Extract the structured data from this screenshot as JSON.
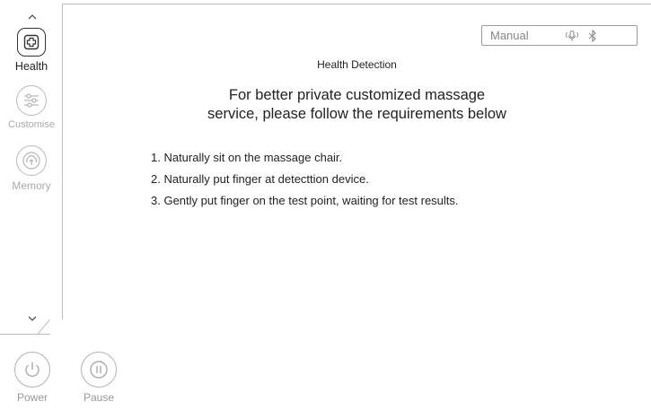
{
  "sidebar": {
    "items": [
      {
        "label": "Health",
        "icon": "health-cross-icon",
        "active": true
      },
      {
        "label": "Customise",
        "icon": "sliders-icon",
        "active": false
      },
      {
        "label": "Memory",
        "icon": "cloud-upload-icon",
        "active": false
      }
    ]
  },
  "controls": {
    "power_label": "Power",
    "pause_label": "Pause"
  },
  "status_bar": {
    "mode": "Manual",
    "icons": [
      "voice-icon",
      "bluetooth-icon"
    ]
  },
  "main": {
    "title": "Health Detection",
    "headline_line1": "For better private customized massage",
    "headline_line2": "service, please follow the requirements below",
    "steps": [
      "1. Naturally sit on the massage chair.",
      "2. Naturally put finger at detecttion device.",
      "3. Gently put finger on the test point, waiting for test results."
    ]
  },
  "colors": {
    "border": "#bdbdbd",
    "active": "#333333",
    "inactive": "#aaaaaa"
  }
}
